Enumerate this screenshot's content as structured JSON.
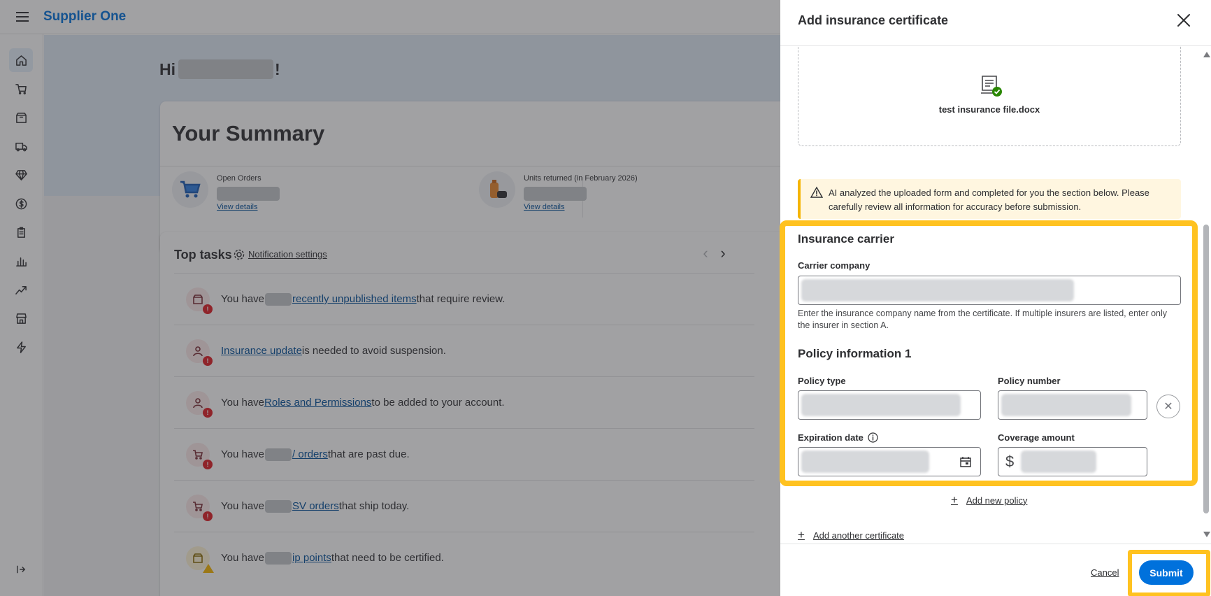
{
  "header": {
    "brand": "Supplier One"
  },
  "sidebar": {
    "items": [
      {
        "icon": "home-icon",
        "active": true
      },
      {
        "icon": "cart-icon"
      },
      {
        "icon": "box-icon"
      },
      {
        "icon": "truck-icon"
      },
      {
        "icon": "diamond-icon"
      },
      {
        "icon": "dollar-icon"
      },
      {
        "icon": "clipboard-icon"
      },
      {
        "icon": "bar-chart-icon"
      },
      {
        "icon": "trend-icon"
      },
      {
        "icon": "store-icon"
      },
      {
        "icon": "lightning-icon"
      }
    ],
    "collapse_icon": "collapse-sidebar-icon"
  },
  "dashboard": {
    "greeting_prefix": "Hi",
    "greeting_suffix": "!",
    "summary": {
      "title": "Your Summary",
      "stats": [
        {
          "label": "Open Orders",
          "link": "View details"
        },
        {
          "label": "Units returned (in February 2026)",
          "link": "View details"
        }
      ]
    },
    "tasks": {
      "title": "Top tasks",
      "notification_link": "Notification settings",
      "items": [
        {
          "before": "You have",
          "link": " recently unpublished items",
          "after": " that require review."
        },
        {
          "before": "",
          "link": "Insurance update",
          "after": " is needed to avoid suspension."
        },
        {
          "before": "You have ",
          "link": "Roles and Permissions",
          "after": " to be added to your account."
        },
        {
          "before": "You have",
          "link": "/ orders",
          "after": " that are past due."
        },
        {
          "before": "You have",
          "link": "SV orders",
          "after": " that ship today."
        },
        {
          "before": "You have",
          "link": "ip points",
          "after": " that need to be certified."
        }
      ]
    }
  },
  "drawer": {
    "title": "Add insurance certificate",
    "file_name": "test insurance file.docx",
    "ai_notice": "AI analyzed the uploaded form and completed for you the section below. Please carefully review all information for accuracy before submission.",
    "carrier_section": "Insurance carrier",
    "carrier_label": "Carrier company",
    "carrier_helper": "Enter the insurance company name from the certificate. If multiple insurers are listed, enter only the insurer in section A.",
    "policy_section": "Policy information 1",
    "policy_type_label": "Policy type",
    "policy_number_label": "Policy number",
    "expiration_label": "Expiration date",
    "coverage_label": "Coverage amount",
    "currency_symbol": "$",
    "add_policy": "Add new policy",
    "add_certificate": "Add another certificate",
    "cancel": "Cancel",
    "submit": "Submit"
  }
}
